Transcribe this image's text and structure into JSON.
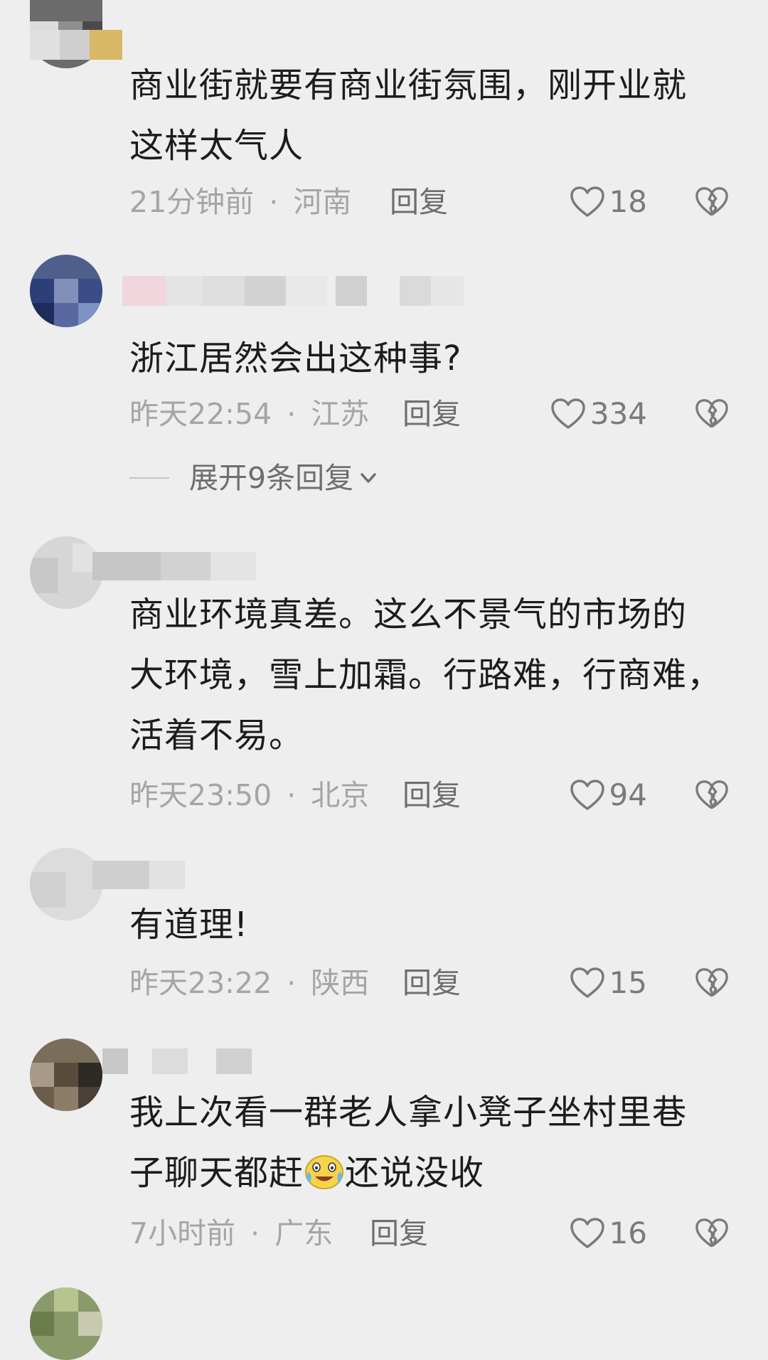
{
  "comments": [
    {
      "text": "商业街就要有商业街氛围，刚开业就\n这样太气人",
      "time": "21分钟前",
      "sep": "·",
      "region": "河南",
      "reply_label": "回复",
      "likes": "18"
    },
    {
      "text": "浙江居然会出这种事?",
      "time": "昨天22:54",
      "sep": "·",
      "region": "江苏",
      "reply_label": "回复",
      "likes": "334",
      "expand_label": "展开9条回复"
    },
    {
      "text": "商业环境真差。这么不景气的市场的\n大环境，雪上加霜。行路难，行商难，\n活着不易。",
      "time": "昨天23:50",
      "sep": "·",
      "region": "北京",
      "reply_label": "回复",
      "likes": "94"
    },
    {
      "text": "有道理!",
      "time": "昨天23:22",
      "sep": "·",
      "region": "陕西",
      "reply_label": "回复",
      "likes": "15"
    },
    {
      "text_part1": "我上次看一群老人拿小凳子坐村里巷\n子聊天都赶",
      "emoji": "crying-laughing-emoji",
      "text_part2": "还说没收",
      "time": "7小时前",
      "sep": "·",
      "region": "广东",
      "reply_label": "回复",
      "likes": "16"
    }
  ],
  "icons": {
    "like": "heart-outline-icon",
    "dislike": "broken-heart-icon",
    "expand": "chevron-down-icon"
  },
  "colors": {
    "background": "#eeeeee",
    "text": "#1c1c1c",
    "meta": "#a5a5a5",
    "action": "#6e6e6e"
  }
}
